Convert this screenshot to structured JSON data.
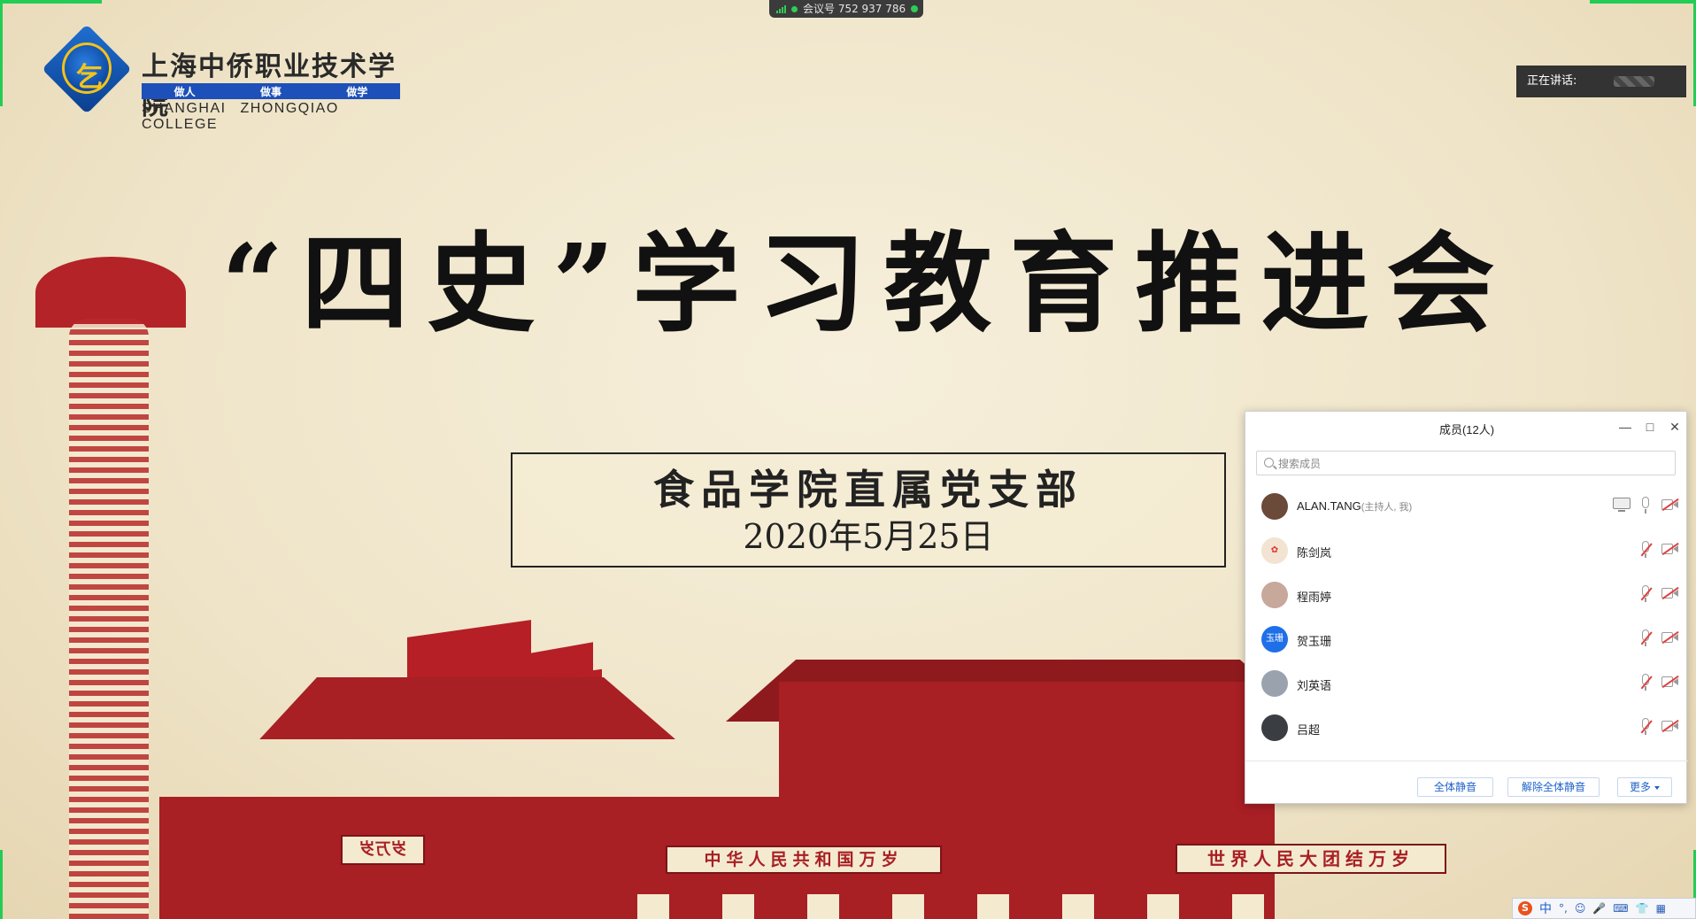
{
  "slide": {
    "logo": {
      "cn_name": "上海中侨职业技术学院",
      "mark": "乞",
      "motto": [
        "做人",
        "做事",
        "做学"
      ],
      "en_name": "SHANGHAI ZHONGQIAO COLLEGE"
    },
    "title": "“四史”学习教育推进会",
    "subtitle": "食品学院直属党支部",
    "date": "2020年5月25日",
    "banners": {
      "far_left": "岁万岁",
      "left": "中华人民共和国万岁",
      "right": "世界人民大团结万岁"
    }
  },
  "meeting": {
    "id_label": "会议号 752 937 786",
    "speaking_label": "正在讲话:"
  },
  "panel": {
    "title": "成员(12人)",
    "minimize": "—",
    "maximize": "□",
    "close": "✕",
    "search_placeholder": "搜索成员",
    "members": [
      {
        "name": "ALAN.TANG",
        "role": "(主持人, 我)",
        "avatar_text": "",
        "avatar_color": "#6b4a3a",
        "sharing": true,
        "mic_muted": false
      },
      {
        "name": "陈剑岚",
        "role": "",
        "avatar_text": "✿",
        "avatar_color": "#f3e3d2",
        "sharing": false,
        "mic_muted": true
      },
      {
        "name": "程雨婷",
        "role": "",
        "avatar_text": "",
        "avatar_color": "#c7a89a",
        "sharing": false,
        "mic_muted": true
      },
      {
        "name": "贺玉珊",
        "role": "",
        "avatar_text": "玉珊",
        "avatar_color": "#1f6fe8",
        "sharing": false,
        "mic_muted": true
      },
      {
        "name": "刘英语",
        "role": "",
        "avatar_text": "",
        "avatar_color": "#9aa3ad",
        "sharing": false,
        "mic_muted": true
      },
      {
        "name": "吕超",
        "role": "",
        "avatar_text": "",
        "avatar_color": "#3a3d42",
        "sharing": false,
        "mic_muted": true
      }
    ],
    "buttons": {
      "mute_all": "全体静音",
      "unmute_all": "解除全体静音",
      "more": "更多"
    }
  },
  "ime": {
    "logo": "S",
    "lang": "中",
    "punct": "°,",
    "items": [
      "☺",
      "🎤",
      "⌨",
      "👕",
      "▦"
    ]
  },
  "colors": {
    "accent_blue": "#1f62c9",
    "slide_red": "#a81f24",
    "indicator_green": "#22cc55"
  }
}
